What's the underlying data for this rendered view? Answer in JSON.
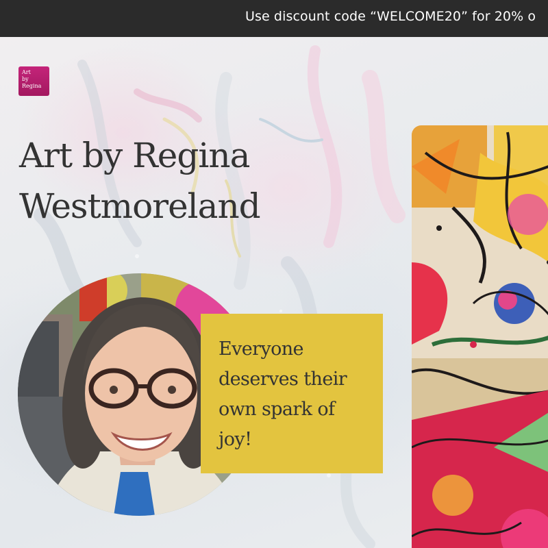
{
  "announcement": {
    "text": "Use discount code “WELCOME20” for 20% o"
  },
  "logo": {
    "line1": "Art",
    "line2": "by",
    "line3": "Regina"
  },
  "hero": {
    "title": "Art by Regina Westmoreland",
    "quote": "Everyone deserves their own spark of joy!"
  },
  "colors": {
    "announcement_bg": "#2b2b2b",
    "logo_bg": "#b31e6c",
    "quote_bg": "#e3c43f",
    "text": "#333333"
  }
}
